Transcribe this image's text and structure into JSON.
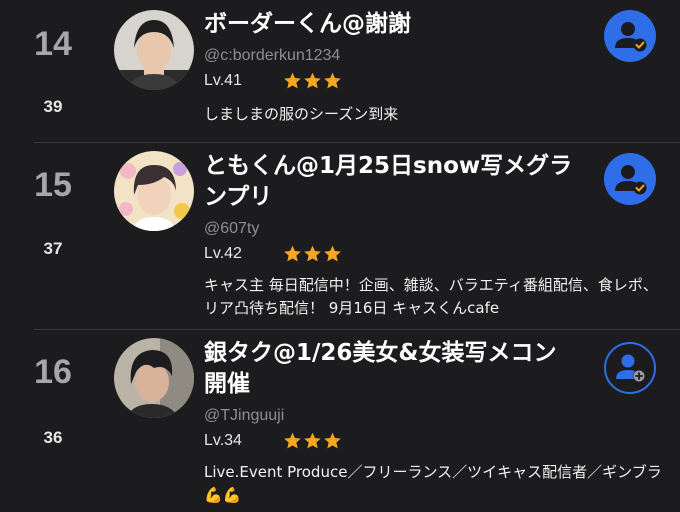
{
  "colors": {
    "background": "#1c1c1e",
    "accent": "#2f6ee8",
    "star": "#f5a623",
    "check": "#f5a623",
    "rank": "#a6a6ab",
    "handle": "#8e8e93"
  },
  "entries": [
    {
      "rank": "14",
      "count": "39",
      "name": "ボーダーくん@謝謝",
      "handle": "@c:borderkun1234",
      "level": "Lv.41",
      "stars": 3,
      "bio": "しましまの服のシーズン到来",
      "follow_state": "followed",
      "follow_icon": "user-check-icon"
    },
    {
      "rank": "15",
      "count": "37",
      "name": "ともくん@1月25日snow写メグランプリ",
      "handle": "@607ty",
      "level": "Lv.42",
      "stars": 3,
      "bio": "キャス主 毎日配信中！企画、雑談、バラエティ番組配信、食レポ、リア凸待ち配信！ 9月16日 キャスくんcafe",
      "follow_state": "followed",
      "follow_icon": "user-check-icon"
    },
    {
      "rank": "16",
      "count": "36",
      "name": "銀タク@1/26美女&女装写メコン開催",
      "handle": "@TJinguuji",
      "level": "Lv.34",
      "stars": 3,
      "bio": "Live.Event Produce／フリーランス／ツイキャス配信者／ギンブラ💪💪",
      "follow_state": "not-followed",
      "follow_icon": "user-add-icon"
    }
  ]
}
